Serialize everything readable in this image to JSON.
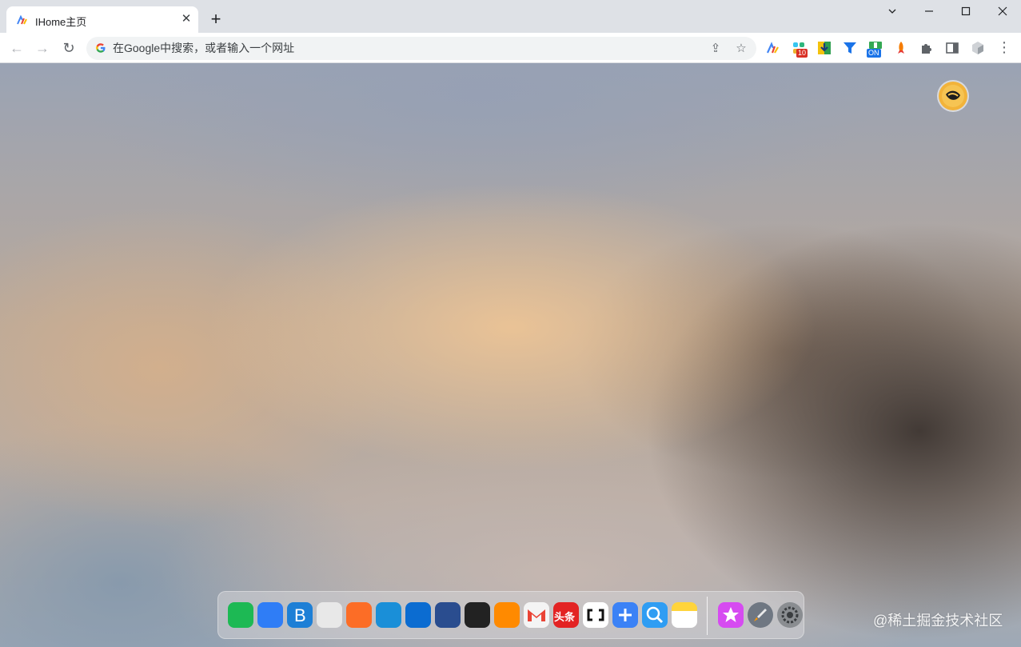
{
  "tab": {
    "title": "IHome主页",
    "close_glyph": "✕",
    "favicon": "ihome-logo-icon"
  },
  "new_tab_glyph": "+",
  "window_controls": {
    "tab_search": "⌄",
    "minimize": "—",
    "maximize": "☐",
    "close": "✕"
  },
  "toolbar": {
    "back_glyph": "←",
    "forward_glyph": "→",
    "reload_glyph": "↻",
    "search_placeholder": "在Google中搜索，或者输入一个网址",
    "search_value": "",
    "share_glyph": "⇪",
    "bookmark_glyph": "☆",
    "menu_glyph": "⋮"
  },
  "extensions": [
    {
      "name": "ihome-extension-icon",
      "badge": ""
    },
    {
      "name": "slack-extension-icon",
      "badge": "10",
      "badge_color": "#d93025"
    },
    {
      "name": "download-extension-icon",
      "badge": ""
    },
    {
      "name": "filter-extension-icon",
      "badge": ""
    },
    {
      "name": "toggle-extension-icon",
      "badge": "ON",
      "badge_color": "#1a73e8"
    },
    {
      "name": "rocket-extension-icon",
      "badge": ""
    },
    {
      "name": "puzzle-extensions-icon",
      "badge": ""
    },
    {
      "name": "side-panel-icon",
      "badge": ""
    },
    {
      "name": "profile-cube-icon",
      "badge": ""
    }
  ],
  "dock_apps": [
    {
      "name": "files-app-icon",
      "color": "#1db954"
    },
    {
      "name": "qq-app-icon",
      "color": "#2f7df6"
    },
    {
      "name": "b-app-icon",
      "color": "#1d7fd6"
    },
    {
      "name": "chrome-app-icon",
      "color": "#e8e8e8"
    },
    {
      "name": "gitlab-app-icon",
      "color": "#fc6d26"
    },
    {
      "name": "edge-app-icon",
      "color": "#1a8fd8"
    },
    {
      "name": "messenger-app-icon",
      "color": "#0b6cd1"
    },
    {
      "name": "notes-dark-app-icon",
      "color": "#2a4d8f"
    },
    {
      "name": "terminal-app-icon",
      "color": "#222222"
    },
    {
      "name": "aliyun-app-icon",
      "color": "#ff8a00"
    },
    {
      "name": "gmail-app-icon",
      "color": "#f4f4f4"
    },
    {
      "name": "toutiao-app-icon",
      "color": "#e32323"
    },
    {
      "name": "code-app-icon",
      "color": "#ffffff"
    },
    {
      "name": "add-app-icon",
      "color": "#3b82f6"
    },
    {
      "name": "search-app-icon",
      "color": "#2f9df3"
    },
    {
      "name": "memo-app-icon",
      "color": "#ffd43b"
    },
    {
      "name": "favorites-app-icon",
      "color": "#d64bf1"
    },
    {
      "name": "launchpad-app-icon",
      "color": "#6f7782"
    },
    {
      "name": "settings-app-icon",
      "color": "#8a8d91"
    }
  ],
  "toutiao_label": "头条",
  "watermark": "@稀土掘金技术社区"
}
